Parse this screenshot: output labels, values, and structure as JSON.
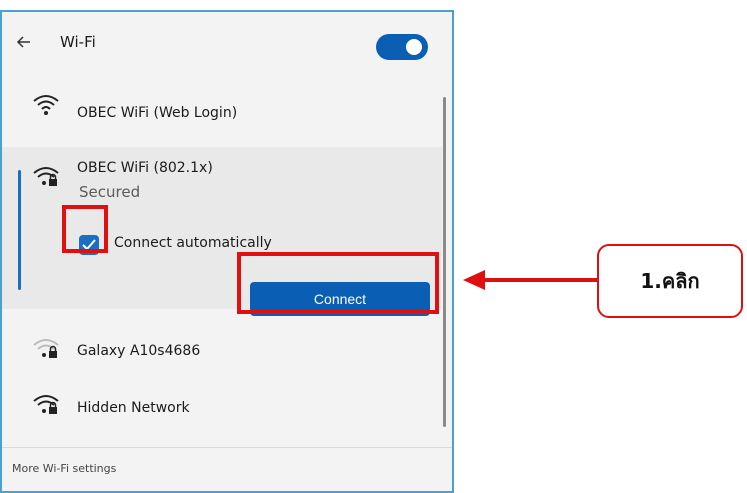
{
  "panel": {
    "title": "Wi-Fi",
    "wifi_enabled": true
  },
  "networks": [
    {
      "name": "OBEC WiFi (Web Login)",
      "icon": "wifi-signal-icon"
    },
    {
      "name": "OBEC WiFi (802.1x)",
      "status": "Secured",
      "icon": "wifi-lock-icon"
    },
    {
      "name": "Galaxy A10s4686",
      "icon": "wifi-lock-icon"
    },
    {
      "name": "Hidden Network",
      "icon": "wifi-lock-icon"
    }
  ],
  "expanded": {
    "auto_connect_label": "Connect automatically",
    "auto_connect_checked": true,
    "connect_label": "Connect"
  },
  "footer": {
    "settings_link": "More Wi-Fi settings"
  },
  "annotation": {
    "callout_text": "1.คลิก",
    "highlight_color": "#e01010"
  },
  "colors": {
    "accent": "#0a5fb4",
    "panel_bg": "#f3f3f3"
  }
}
